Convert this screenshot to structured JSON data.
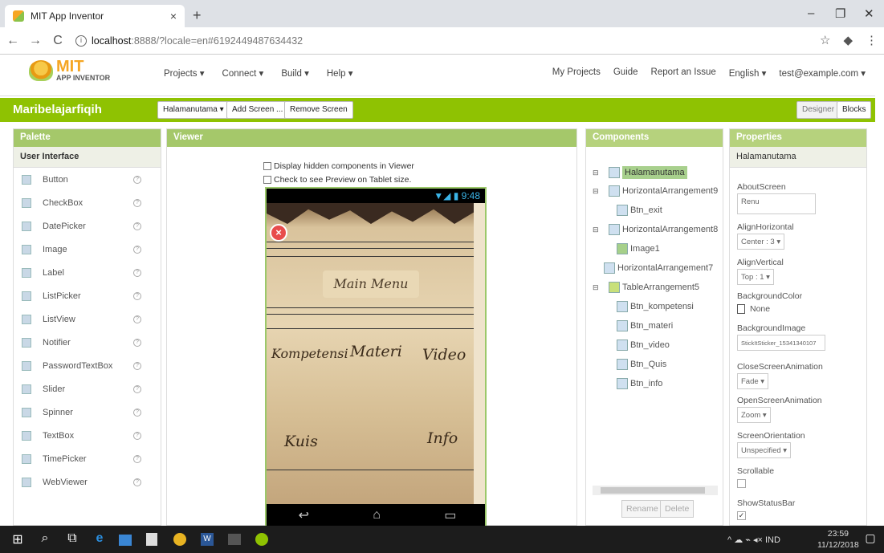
{
  "browser": {
    "tab_title": "MIT App Inventor",
    "tab_close": "×",
    "new_tab": "+",
    "url_host": "localhost",
    "url_path": ":8888/?locale=en#6192449487634432",
    "win_min": "–",
    "win_max": "❐",
    "win_close": "✕",
    "back": "←",
    "forward": "→",
    "reload": "C",
    "star": "☆",
    "ext": "◆",
    "menu_dots": "⋮"
  },
  "app": {
    "logo_main": "MIT",
    "logo_sub": "APP INVENTOR",
    "menu": [
      "Projects ▾",
      "Connect ▾",
      "Build ▾",
      "Help ▾"
    ],
    "menu_right": [
      "My Projects",
      "Guide",
      "Report an Issue",
      "English ▾",
      "test@example.com ▾"
    ]
  },
  "toolbar": {
    "project_name": "Maribelajarfiqih",
    "screen_select": "Halamanutama ▾",
    "add_screen": "Add Screen ...",
    "remove_screen": "Remove Screen",
    "designer": "Designer",
    "blocks": "Blocks"
  },
  "palette": {
    "title": "Palette",
    "section": "User Interface",
    "items": [
      "Button",
      "CheckBox",
      "DatePicker",
      "Image",
      "Label",
      "ListPicker",
      "ListView",
      "Notifier",
      "PasswordTextBox",
      "Slider",
      "Spinner",
      "TextBox",
      "TimePicker",
      "WebViewer"
    ],
    "help": "?"
  },
  "viewer": {
    "title": "Viewer",
    "hidden_chk": "Display hidden components in Viewer",
    "tablet_chk": "Check to see Preview on Tablet size.",
    "status_time": "▼◢ ▮ 9:48",
    "exit_label": "×",
    "main_menu": "Main Menu",
    "cells": [
      "Kompetensi",
      "Materi",
      "Video",
      "Kuis",
      "Info"
    ],
    "nav": [
      "↩",
      "⌂",
      "▭"
    ]
  },
  "components": {
    "title": "Components",
    "tree": [
      {
        "label": "Halamanutama",
        "toggle": "⊟"
      },
      {
        "label": "HorizontalArrangement9",
        "toggle": "⊟"
      },
      {
        "label": "Btn_exit",
        "toggle": ""
      },
      {
        "label": "HorizontalArrangement8",
        "toggle": "⊟"
      },
      {
        "label": "Image1",
        "toggle": ""
      },
      {
        "label": "HorizontalArrangement7",
        "toggle": ""
      },
      {
        "label": "TableArrangement5",
        "toggle": "⊟"
      },
      {
        "label": "Btn_kompetensi",
        "toggle": ""
      },
      {
        "label": "Btn_materi",
        "toggle": ""
      },
      {
        "label": "Btn_video",
        "toggle": ""
      },
      {
        "label": "Btn_Quis",
        "toggle": ""
      },
      {
        "label": "Btn_info",
        "toggle": ""
      }
    ],
    "rename": "Rename",
    "delete": "Delete"
  },
  "properties": {
    "title": "Properties",
    "component": "Halamanutama",
    "about_label": "AboutScreen",
    "about_value": "Renu",
    "align_h_label": "AlignHorizontal",
    "align_h_value": "Center : 3 ▾",
    "align_v_label": "AlignVertical",
    "align_v_value": "Top : 1 ▾",
    "bgcolor_label": "BackgroundColor",
    "bgcolor_value": "None",
    "bgimage_label": "BackgroundImage",
    "bgimage_value": "StickItSticker_15341340107",
    "close_anim_label": "CloseScreenAnimation",
    "close_anim_value": "Fade ▾",
    "open_anim_label": "OpenScreenAnimation",
    "open_anim_value": "Zoom ▾",
    "orientation_label": "ScreenOrientation",
    "orientation_value": "Unspecified ▾",
    "scrollable_label": "Scrollable",
    "statusbar_label": "ShowStatusBar",
    "statusbar_check": "✓"
  },
  "taskbar": {
    "start": "⊞",
    "search": "⌕",
    "taskview": "⧉",
    "tray": "^ ☁ ⌁ ◂× IND",
    "time": "23:59",
    "date": "11/12/2018",
    "notify": "▢"
  },
  "colors": {
    "accent_green": "#8fc202",
    "panel_header": "#a5c86a"
  }
}
